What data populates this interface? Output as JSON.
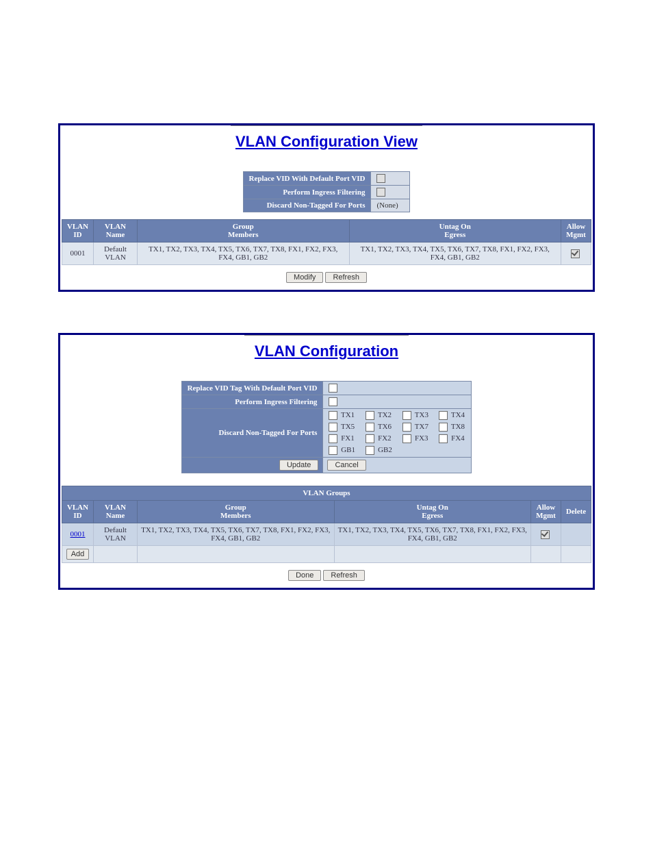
{
  "panel1": {
    "title": "VLAN Configuration View",
    "settings": {
      "replace_vid_label": "Replace VID With Default Port VID",
      "perform_ingress_label": "Perform Ingress Filtering",
      "discard_nontagged_label": "Discard Non-Tagged For Ports",
      "discard_nontagged_value": "(None)"
    },
    "headers": {
      "vlan_id": "VLAN ID",
      "vlan_name": "VLAN Name",
      "group_members": "Group\nMembers",
      "untag_on_egress": "Untag On\nEgress",
      "allow_mgmt": "Allow Mgmt"
    },
    "row": {
      "id": "0001",
      "name": "Default VLAN",
      "members": "TX1, TX2, TX3, TX4, TX5, TX6, TX7, TX8, FX1, FX2, FX3, FX4, GB1, GB2",
      "untag": "TX1, TX2, TX3, TX4, TX5, TX6, TX7, TX8, FX1, FX2, FX3, FX4, GB1, GB2"
    },
    "buttons": {
      "modify": "Modify",
      "refresh": "Refresh"
    }
  },
  "panel2": {
    "title": "VLAN Configuration",
    "settings": {
      "replace_vid_label": "Replace VID Tag With Default Port VID",
      "perform_ingress_label": "Perform Ingress Filtering",
      "discard_nontagged_label": "Discard Non-Tagged For Ports"
    },
    "ports": [
      "TX1",
      "TX2",
      "TX3",
      "TX4",
      "TX5",
      "TX6",
      "TX7",
      "TX8",
      "FX1",
      "FX2",
      "FX3",
      "FX4",
      "GB1",
      "GB2"
    ],
    "buttons_upper": {
      "update": "Update",
      "cancel": "Cancel"
    },
    "groups_title": "VLAN Groups",
    "headers": {
      "vlan_id": "VLAN ID",
      "vlan_name": "VLAN Name",
      "group_members": "Group\nMembers",
      "untag_on_egress": "Untag On\nEgress",
      "allow_mgmt": "Allow Mgmt",
      "delete": "Delete"
    },
    "row": {
      "id": "0001",
      "name": "Default VLAN",
      "members": "TX1, TX2, TX3, TX4, TX5, TX6, TX7, TX8, FX1, FX2, FX3, FX4, GB1, GB2",
      "untag": "TX1, TX2, TX3, TX4, TX5, TX6, TX7, TX8, FX1, FX2, FX3, FX4, GB1, GB2"
    },
    "buttons_lower": {
      "add": "Add",
      "done": "Done",
      "refresh": "Refresh"
    }
  }
}
